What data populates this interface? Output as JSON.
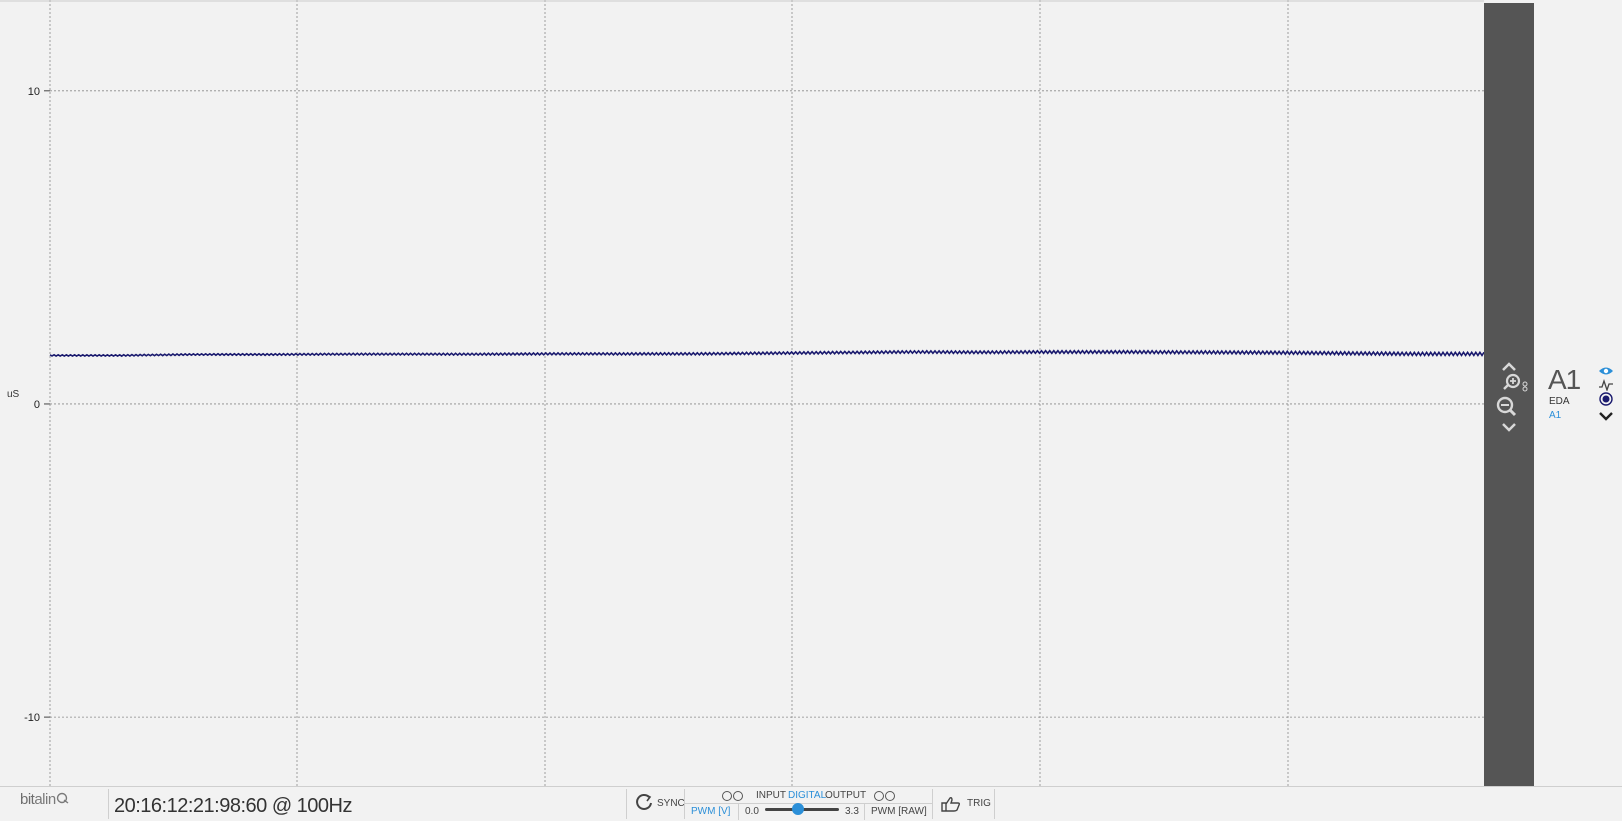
{
  "chart_data": {
    "type": "line",
    "ylabel": "uS",
    "yticks": [
      "10",
      "0",
      "-10"
    ],
    "ytick_values": [
      10,
      0,
      -10
    ],
    "ylim": [
      -12.2,
      12.9
    ],
    "grid": true,
    "grid_style": "dashed",
    "series": [
      {
        "color": "#1a1a6e",
        "x": [
          0,
          0.05,
          0.1,
          0.15,
          0.2,
          0.25,
          0.3,
          0.35,
          0.4,
          0.45,
          0.5,
          0.55,
          0.6,
          0.65,
          0.7,
          0.75,
          0.8,
          0.85,
          0.9,
          0.95,
          1.0
        ],
        "values": [
          1.55,
          1.55,
          1.58,
          1.58,
          1.59,
          1.59,
          1.59,
          1.6,
          1.6,
          1.6,
          1.62,
          1.64,
          1.66,
          1.65,
          1.66,
          1.66,
          1.65,
          1.64,
          1.62,
          1.6,
          1.6
        ]
      }
    ]
  },
  "channel": {
    "id": "A1",
    "sensor": "EDA",
    "port": "A1"
  },
  "icons": {
    "zoom_in": "zoom-in-icon",
    "zoom_out": "zoom-out-icon",
    "visibility": "eye-icon",
    "signal": "waveform-icon",
    "record": "record-icon",
    "expand": "chevron-down-icon"
  },
  "toolbar": {
    "logo_part1": "bit",
    "logo_part2": "alin",
    "device_status": "20:16:12:21:98:60 @ 100Hz",
    "sync_label": "SYNC",
    "input_label": "INPUT",
    "digital_label": "DIGITAL",
    "output_label": "OUTPUT",
    "pwm_v_label": "PWM [V]",
    "pwm_min": "0.0",
    "pwm_max": "3.3",
    "pwm_value_fraction": 0.45,
    "pwm_raw_label": "PWM [RAW]",
    "trig_label": "TRIG"
  },
  "colors": {
    "accent": "#2b8fd8",
    "signal": "#1a1a6e",
    "zoom_bar": "#555555",
    "background": "#f2f2f2"
  }
}
